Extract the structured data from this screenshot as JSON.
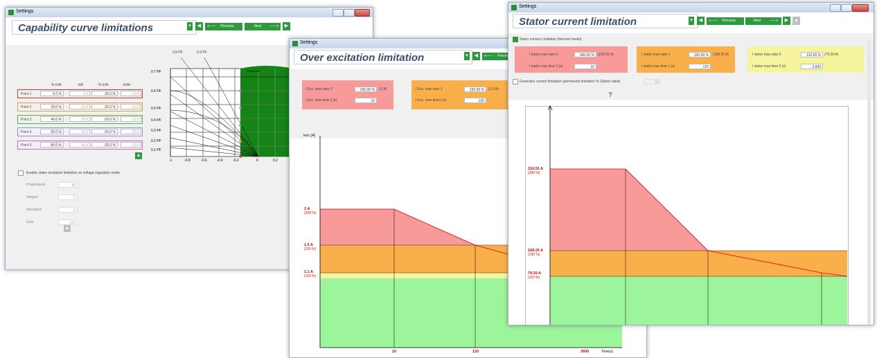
{
  "win1": {
    "title": "Settings",
    "header": "Capability curve limitations",
    "prev_label": "Previous",
    "next_label": "Next",
    "table_headers": [
      "% kVA",
      "kW",
      "% kVA",
      "kVAr"
    ],
    "points": [
      {
        "name": "Point 1",
        "c1": "0.0 %",
        "c2": "0.0",
        "c3": "-20.0 %",
        "c4": "-10.0",
        "color": "#e03030"
      },
      {
        "name": "Point 2",
        "c1": "20.0 %",
        "c2": "10.0",
        "c3": "-20.0 %",
        "c4": "-10.0",
        "color": "#f0a030"
      },
      {
        "name": "Point 3",
        "c1": "40.0 %",
        "c2": "20.0",
        "c3": "-20.0 %",
        "c4": "-10.0",
        "color": "#40c040"
      },
      {
        "name": "Point 4",
        "c1": "60.0 %",
        "c2": "30.0",
        "c3": "-20.0 %",
        "c4": "-10.0",
        "color": "#9090e0"
      },
      {
        "name": "Point 5",
        "c1": "80.0 %",
        "c2": "40.0",
        "c3": "-20.0 %",
        "c4": "-10.0",
        "color": "#d060d0"
      }
    ],
    "pf_top": [
      "0.8 PF",
      "0.9 PF"
    ],
    "pf_left": [
      "0.7 PF",
      "0.6 PF",
      "0.5 PF",
      "0.4 PF",
      "0.3 PF",
      "0.2 PF",
      "0.1 PF"
    ],
    "x_ticks": [
      "-1",
      "-0.8",
      "-0.6",
      "-0.4",
      "-0.2",
      "0",
      "0.2"
    ],
    "chart_inner_label": "P(kW/kVA)",
    "enable_label": "Enable under excitation limitation on voltage regulation mode",
    "params": [
      {
        "label": "Proportional",
        "value": "40"
      },
      {
        "label": "Integral",
        "value": "2"
      },
      {
        "label": "Derivative",
        "value": "0"
      },
      {
        "label": "Gain",
        "value": "100"
      }
    ]
  },
  "win2": {
    "title": "Settings",
    "header": "Over excitation limitation",
    "prev_label": "Previous",
    "f1_label": "I Exc. max ratio 2",
    "f1_value": "200.00 %",
    "f1_extra": "(2 A)",
    "f2_label": "I Exc. max time 2 (s)",
    "f2_value": "10",
    "f3_label": "I Exc. max ratio 1",
    "f3_value": "150.00 %",
    "f3_extra": "(1.5 A)",
    "f4_label": "I Exc. max time1 (s)",
    "f4_value": "120",
    "y_label": "Iexc (A)",
    "x_label": "Time(s)",
    "lvl1": "2 A",
    "lvl1_pct": "(200 %)",
    "lvl2": "1.5 A",
    "lvl2_pct": "(110 %)",
    "lvl3": "1.1 A",
    "lvl3_pct": "(110 %)",
    "t1": "10",
    "t2": "120",
    "t3": "3600"
  },
  "win3": {
    "title": "Settings",
    "header": "Stator current limitation",
    "prev_label": "Previous",
    "next_label": "Next",
    "thermal_label": "Stator current Limitation (thermal model)",
    "f1_label": "I stator max ratio 2",
    "f1_value": "300.00 %",
    "f1_extra": "(216.51 A)",
    "f2_label": "I stator max time 2 (s)",
    "f2_value": "10",
    "f3_label": "I stator max ratio 1",
    "f3_value": "150.00 %",
    "f3_extra": "(108.25 A)",
    "f4_label": "I stator max time 1 (s)",
    "f4_value": "120",
    "f5_label": "I stator max ratio 0",
    "f5_value": "110.00 %",
    "f5_extra": "(79.39 A)",
    "f6_label": "I stator max time 0 (s)",
    "f6_value": "3,600",
    "gen_label": "Generator current limitation (permanent limitation % (Stator rated)",
    "gen_value": "50",
    "help": "?",
    "lvl1": "216.51 A",
    "lvl1_pct": "(300 %)",
    "lvl2": "108.25 A",
    "lvl2_pct": "(150 %)",
    "lvl3": "79.39 A",
    "lvl3_pct": "(110 %)"
  },
  "colors": {
    "red": "#f89a9a",
    "orange": "#f9b04b",
    "yellow": "#f7f4a0",
    "green": "#9cf59a",
    "line": "#e00000",
    "brand": "#2e9a3f"
  }
}
